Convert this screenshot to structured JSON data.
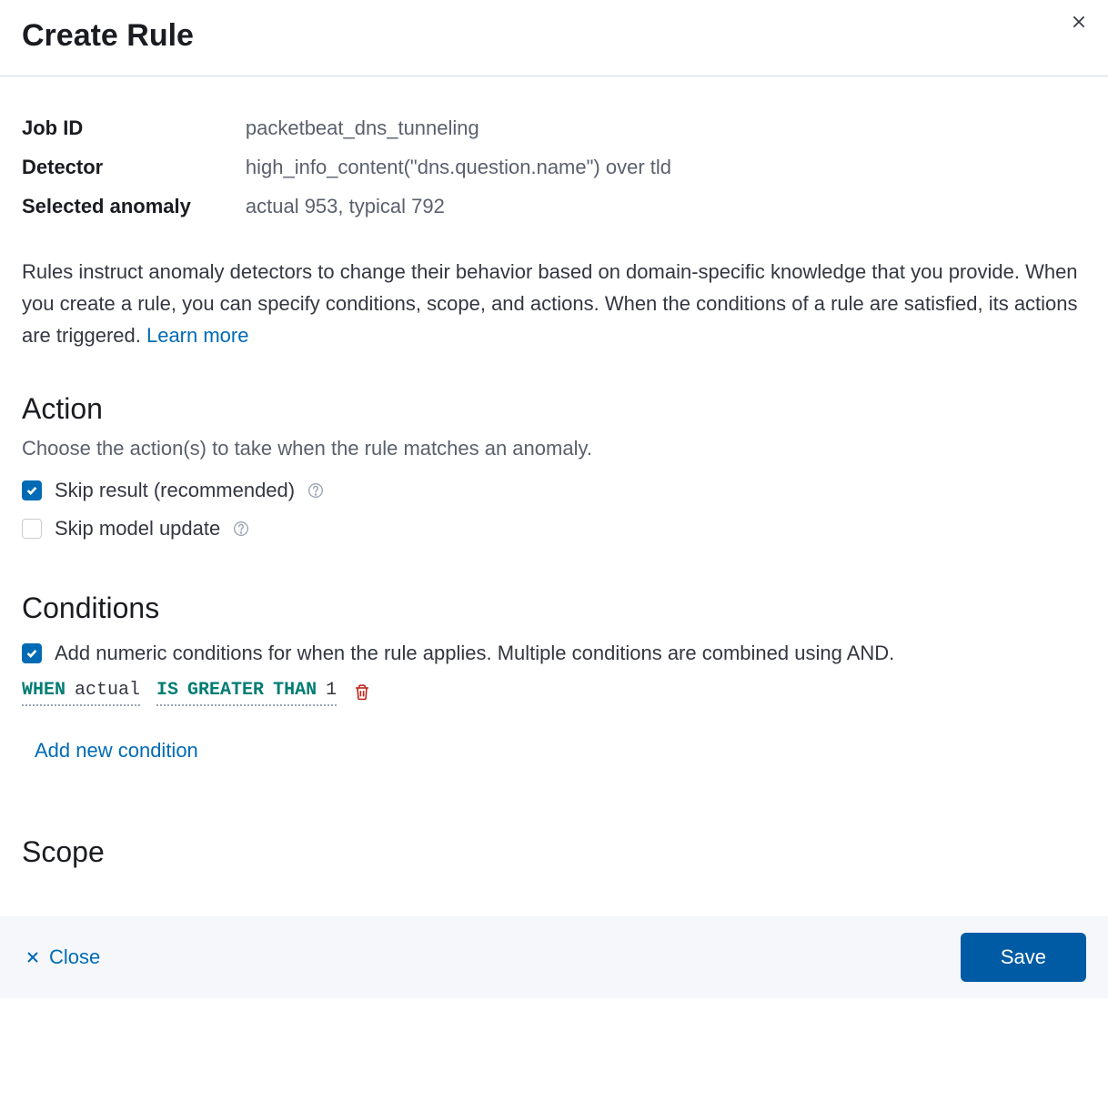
{
  "header": {
    "title": "Create Rule"
  },
  "info": {
    "job_id_label": "Job ID",
    "job_id_value": "packetbeat_dns_tunneling",
    "detector_label": "Detector",
    "detector_value": "high_info_content(\"dns.question.name\") over tld",
    "selected_anomaly_label": "Selected anomaly",
    "selected_anomaly_value": "actual 953, typical 792"
  },
  "description": {
    "text": "Rules instruct anomaly detectors to change their behavior based on domain-specific knowledge that you provide. When you create a rule, you can specify conditions, scope, and actions. When the conditions of a rule are satisfied, its actions are triggered. ",
    "learn_more": "Learn more"
  },
  "action": {
    "title": "Action",
    "subtitle": "Choose the action(s) to take when the rule matches an anomaly.",
    "skip_result_label": "Skip result (recommended)",
    "skip_model_label": "Skip model update"
  },
  "conditions": {
    "title": "Conditions",
    "checkbox_label": "Add numeric conditions for when the rule applies. Multiple conditions are combined using AND.",
    "when": "WHEN",
    "applies_to": "actual",
    "operator_kw1": "IS",
    "operator_kw2": "GREATER",
    "operator_kw3": "THAN",
    "value": "1",
    "add_new": "Add new condition"
  },
  "scope": {
    "title": "Scope"
  },
  "footer": {
    "close_label": "Close",
    "save_label": "Save"
  }
}
